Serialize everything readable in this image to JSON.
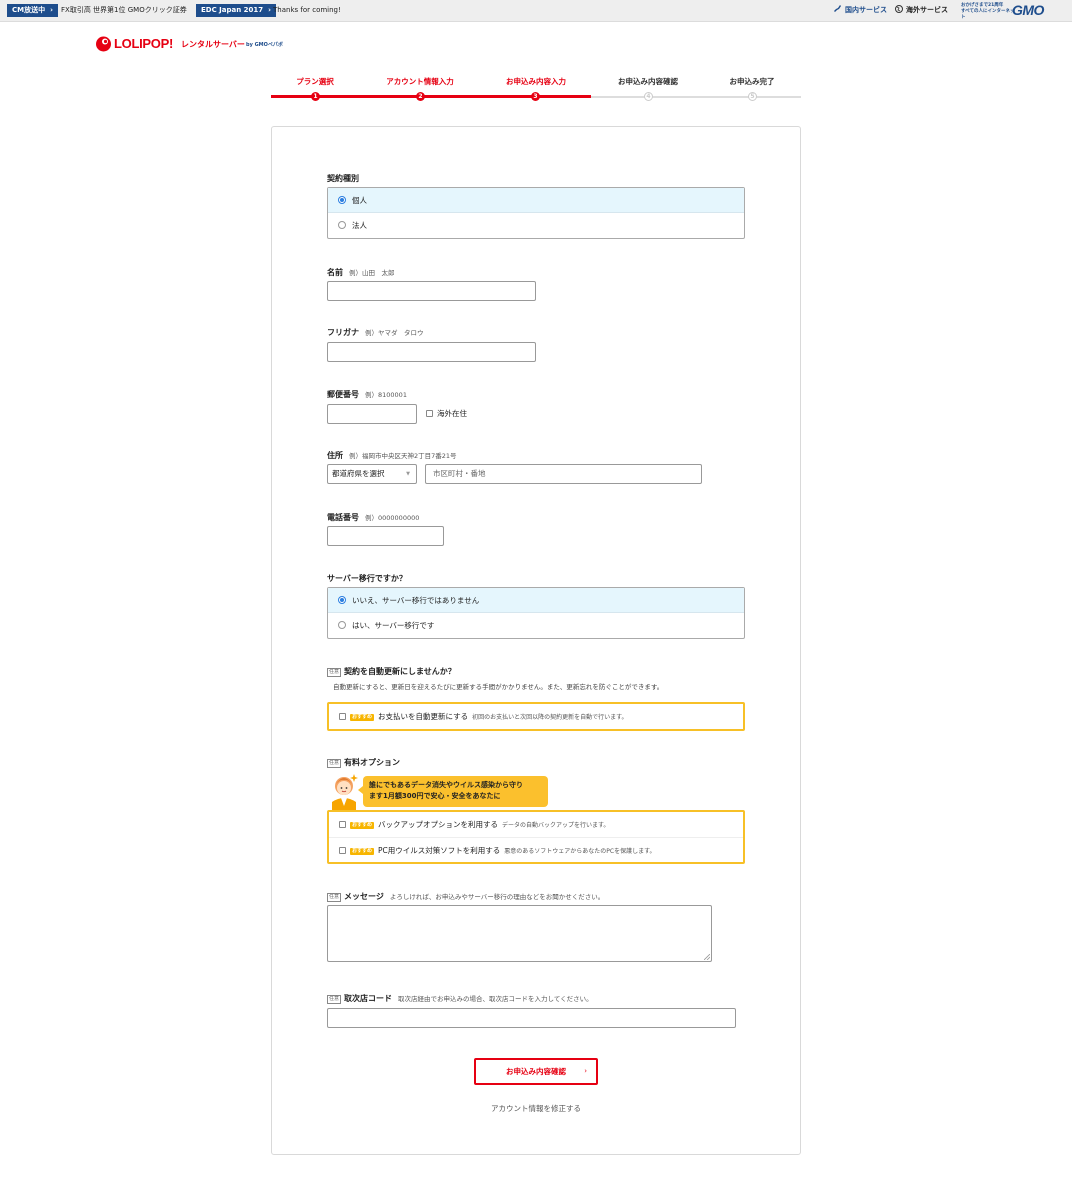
{
  "topbar": {
    "cm_badge": "CM放送中",
    "cm_text": "FX取引高 世界第1位 GMOクリック証券",
    "edc_badge": "EDC Japan 2017",
    "edc_text": "Thanks for coming!",
    "domestic": "国内サービス",
    "overseas": "海外サービス",
    "gmo_tagline_1": "おかげさまで21周年",
    "gmo_tagline_2": "すべての人にインターネット",
    "gmo_logo": "GMO"
  },
  "logo": {
    "brand": "LOLIPOP!",
    "sub": "レンタルサーバー",
    "by": "by GMOペパボ"
  },
  "steps": [
    {
      "label": "プラン選択",
      "num": "1",
      "active": true
    },
    {
      "label": "アカウント情報入力",
      "num": "2",
      "active": true
    },
    {
      "label": "お申込み内容入力",
      "num": "3",
      "active": true
    },
    {
      "label": "お申込み内容確認",
      "num": "4",
      "active": false
    },
    {
      "label": "お申込み完了",
      "num": "5",
      "active": false
    }
  ],
  "form": {
    "contract_type": {
      "label": "契約種別",
      "options": [
        "個人",
        "法人"
      ],
      "selected": "個人"
    },
    "name": {
      "label": "名前",
      "example": "例）山田　太郎",
      "value": ""
    },
    "furigana": {
      "label": "フリガナ",
      "example": "例）ヤマダ　タロウ",
      "value": ""
    },
    "postal": {
      "label": "郵便番号",
      "example": "例）8100001",
      "value": "",
      "overseas_label": "海外在住"
    },
    "address": {
      "label": "住所",
      "example": "例）福岡市中央区天神2丁目7番21号",
      "prefecture_selected": "都道府県を選択",
      "city_placeholder": "市区町村・番地"
    },
    "phone": {
      "label": "電話番号",
      "example": "例）0000000000",
      "value": ""
    },
    "migration": {
      "label": "サーバー移行ですか？",
      "options": [
        "いいえ、サーバー移行ではありません",
        "はい、サーバー移行です"
      ],
      "selected": "いいえ、サーバー移行ではありません"
    },
    "auto_renew": {
      "tag": "任意",
      "label": "契約を自動更新にしませんか？",
      "description": "自動更新にすると、更新日を迎えるたびに更新する手間がかかりません。また、更新忘れを防ぐことができます。",
      "badge": "おすすめ",
      "option_label": "お支払いを自動更新にする",
      "option_desc": "初回のお支払いと次回以降の契約更新を自動で行います。"
    },
    "paid_options": {
      "tag": "任意",
      "label": "有料オプション",
      "bubble_line1": "誰にでもあるデータ消失やウイルス感染から守り",
      "bubble_line2": "ます1月額300円で安心・安全をあなたに",
      "items": [
        {
          "badge": "おすすめ",
          "label": "バックアップオプションを利用する",
          "desc": "データの自動バックアップを行います。"
        },
        {
          "badge": "おすすめ",
          "label": "PC用ウイルス対策ソフトを利用する",
          "desc": "悪意のあるソフトウェアからあなたのPCを保護します。"
        }
      ]
    },
    "message": {
      "tag": "任意",
      "label": "メッセージ",
      "hint": "よろしければ、お申込みやサーバー移行の理由などをお聞かせください。"
    },
    "agency": {
      "tag": "任意",
      "label": "取次店コード",
      "hint": "取次店経由でお申込みの場合、取次店コードを入力してください。"
    },
    "confirm_button": "お申込み内容確認",
    "back_link": "アカウント情報を修正する"
  },
  "colors": {
    "brand_red": "#e60012",
    "gmo_blue": "#1e4d8c",
    "selected_bg": "#e5f6fd",
    "recommend_yellow": "#f7c027"
  }
}
